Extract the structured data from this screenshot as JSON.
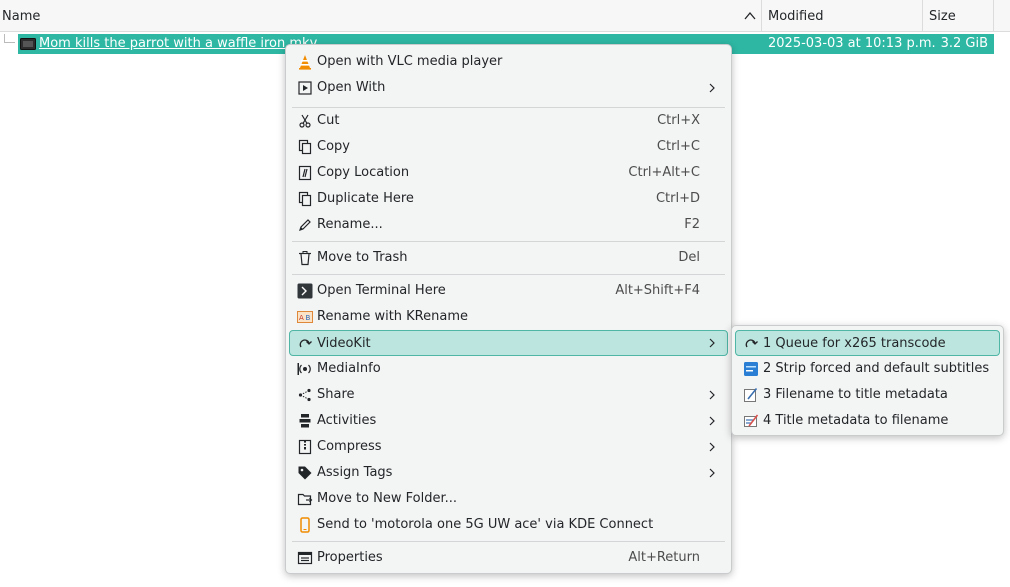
{
  "columns": {
    "name": "Name",
    "modified": "Modified",
    "size": "Size"
  },
  "file": {
    "name": "Mom kills the parrot with a waffle iron.mkv",
    "modified": "2025-03-03 at 10:13 p.m.",
    "size": "3.2 GiB"
  },
  "menu": {
    "open_vlc": "Open with VLC media player",
    "open_with": "Open With",
    "cut": "Cut",
    "cut_sc": "Ctrl+X",
    "copy": "Copy",
    "copy_sc": "Ctrl+C",
    "copy_location": "Copy Location",
    "copy_location_sc": "Ctrl+Alt+C",
    "duplicate": "Duplicate Here",
    "duplicate_sc": "Ctrl+D",
    "rename": "Rename...",
    "rename_sc": "F2",
    "trash": "Move to Trash",
    "trash_sc": "Del",
    "terminal": "Open Terminal Here",
    "terminal_sc": "Alt+Shift+F4",
    "krename": "Rename with KRename",
    "videokit": "VideoKit",
    "mediainfo": "MediaInfo",
    "share": "Share",
    "activities": "Activities",
    "compress": "Compress",
    "assign_tags": "Assign Tags",
    "move_folder": "Move to New Folder...",
    "kdeconnect": "Send to 'motorola one 5G UW ace' via KDE Connect",
    "properties": "Properties",
    "properties_sc": "Alt+Return"
  },
  "submenu": {
    "item1": "1 Queue for x265 transcode",
    "item2": "2 Strip forced and default subtitles",
    "item3": "3 Filename to title metadata",
    "item4": "4 Title metadata to filename"
  },
  "colors": {
    "selection": "#2eb8a4",
    "highlight": "#bde5df",
    "highlight_border": "#4fb5a5"
  }
}
